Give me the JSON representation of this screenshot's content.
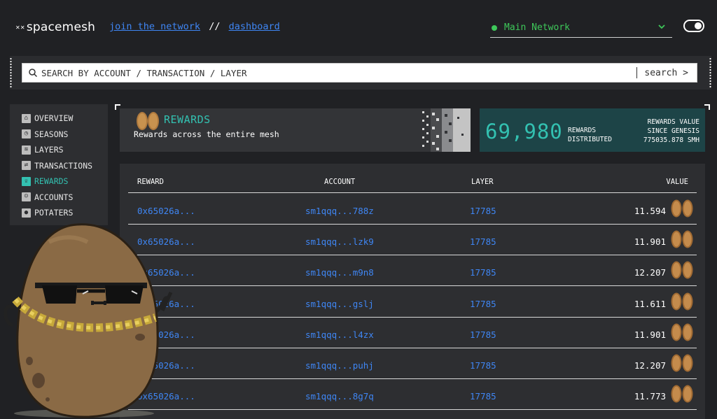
{
  "header": {
    "logo_mark": "✕✕",
    "logo_text": "spacemesh",
    "nav": {
      "join": "join the network",
      "sep": "//",
      "dashboard": "dashboard"
    },
    "network": "Main Network",
    "network_status_color": "#3ec85a"
  },
  "search": {
    "placeholder": "SEARCH BY ACCOUNT / TRANSACTION / LAYER",
    "button": "search >"
  },
  "sidebar": {
    "items": [
      {
        "label": "OVERVIEW",
        "icon": "home-icon"
      },
      {
        "label": "SEASONS",
        "icon": "seasons-icon"
      },
      {
        "label": "LAYERS",
        "icon": "layers-icon"
      },
      {
        "label": "TRANSACTIONS",
        "icon": "transactions-icon"
      },
      {
        "label": "REWARDS",
        "icon": "rewards-icon",
        "active": true
      },
      {
        "label": "ACCOUNTS",
        "icon": "accounts-icon"
      },
      {
        "label": "POTATERS",
        "icon": "potaters-icon"
      }
    ]
  },
  "rewards_card": {
    "title": "REWARDS",
    "subtitle": "Rewards across the entire mesh"
  },
  "stats": {
    "count": "69,980",
    "count_label_1": "REWARDS",
    "count_label_2": "DISTRIBUTED",
    "value_label_1": "REWARDS VALUE",
    "value_label_2": "SINCE GENESIS",
    "value": "775035.878 SMH"
  },
  "table": {
    "headers": {
      "reward": "REWARD",
      "account": "ACCOUNT",
      "layer": "LAYER",
      "value": "VALUE"
    },
    "rows": [
      {
        "reward": "0x65026a...",
        "account": "sm1qqq...788z",
        "layer": "17785",
        "value": "11.594"
      },
      {
        "reward": "0x65026a...",
        "account": "sm1qqq...lzk9",
        "layer": "17785",
        "value": "11.901"
      },
      {
        "reward": "0x65026a...",
        "account": "sm1qqq...m9n8",
        "layer": "17785",
        "value": "12.207"
      },
      {
        "reward": "0x65026a...",
        "account": "sm1qqq...gslj",
        "layer": "17785",
        "value": "11.611"
      },
      {
        "reward": "0x65026a...",
        "account": "sm1qqq...l4zx",
        "layer": "17785",
        "value": "11.901"
      },
      {
        "reward": "0x65026a...",
        "account": "sm1qqq...puhj",
        "layer": "17785",
        "value": "12.207"
      },
      {
        "reward": "0x65026a...",
        "account": "sm1qqq...8g7q",
        "layer": "17785",
        "value": "11.773"
      }
    ]
  },
  "colors": {
    "accent": "#33c1b1",
    "link": "#3f86f4",
    "bg": "#202124",
    "panel": "#2d2e31",
    "stat_bg": "#1d4447"
  }
}
